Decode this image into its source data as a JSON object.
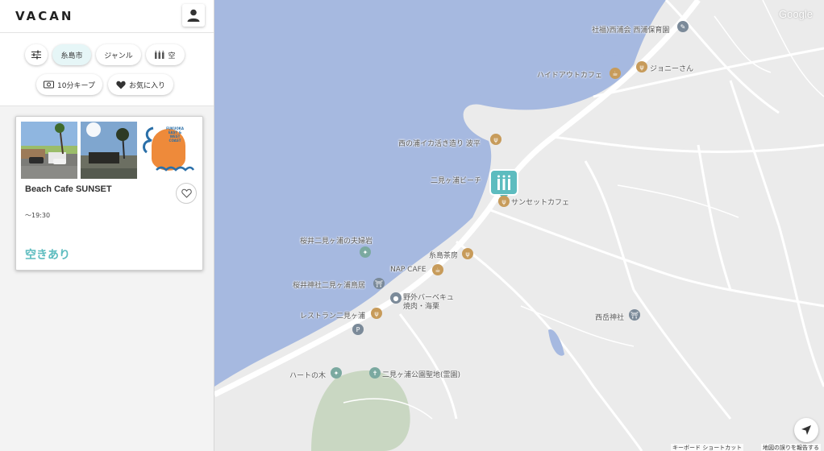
{
  "header": {
    "logo": "VACAN"
  },
  "filters": {
    "settings_icon": "sliders-icon",
    "area": "糸島市",
    "genre": "ジャンル",
    "availability": "空",
    "keep": "10分キープ",
    "favorites": "お気に入り"
  },
  "card": {
    "title": "Beach Cafe SUNSET",
    "hours": "〜19:30",
    "status": "空きあり",
    "logo_lines": [
      "FUKUOKA",
      "EAST &",
      "WEST",
      "COAST"
    ]
  },
  "map": {
    "attribution": "Google",
    "labels": {
      "hoikuen": "社福)西浦会 西浦保育園",
      "hideout": "ハイドアウトカフェ",
      "johnny": "ジョニーさん",
      "ika": "西の浦イカ活き造り 波平",
      "beach": "二見ヶ浦ビーチ",
      "sunset": "サンセットカフェ",
      "meotoiwa": "桜井二見ヶ浦の夫婦岩",
      "itoshima_sabo": "糸島茶房",
      "napcafe": "NAP CAFE",
      "torii": "桜井神社二見ヶ浦鳥居",
      "bbq": "野外バーベキュ",
      "bbq2": "焼肉・海栗",
      "restaurant": "レストラン二見ヶ浦",
      "nishidake": "西岳神社",
      "heart": "ハートの木",
      "cemetery": "二見ヶ浦公園聖地(霊園)"
    },
    "footer": {
      "shortcuts": "キーボード ショートカット",
      "report": "地図の誤りを報告する"
    },
    "colors": {
      "sea": "#a6b9e0",
      "land": "#ebebeb",
      "road": "#ffffff",
      "accent": "#5dbcbf"
    }
  }
}
